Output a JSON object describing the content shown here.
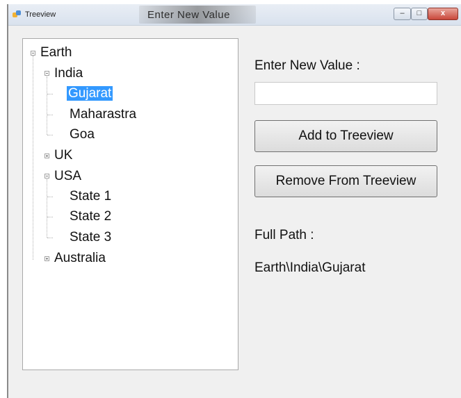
{
  "window": {
    "title": "Treeview",
    "ghost_title": "Enter New Value"
  },
  "controls": {
    "minimize": "–",
    "maximize": "□",
    "close": "x"
  },
  "tree": {
    "root": "Earth",
    "india": "India",
    "gujarat": "Gujarat",
    "maharastra": "Maharastra",
    "goa": "Goa",
    "uk": "UK",
    "usa": "USA",
    "state1": "State 1",
    "state2": "State 2",
    "state3": "State 3",
    "australia": "Australia",
    "selected": "Gujarat",
    "selection_color": "#3399ff"
  },
  "form": {
    "enter_label": "Enter New Value :",
    "input_value": "",
    "add_button": "Add to Treeview",
    "remove_button": "Remove From Treeview",
    "full_path_label": "Full Path :",
    "full_path_value": "Earth\\India\\Gujarat"
  }
}
